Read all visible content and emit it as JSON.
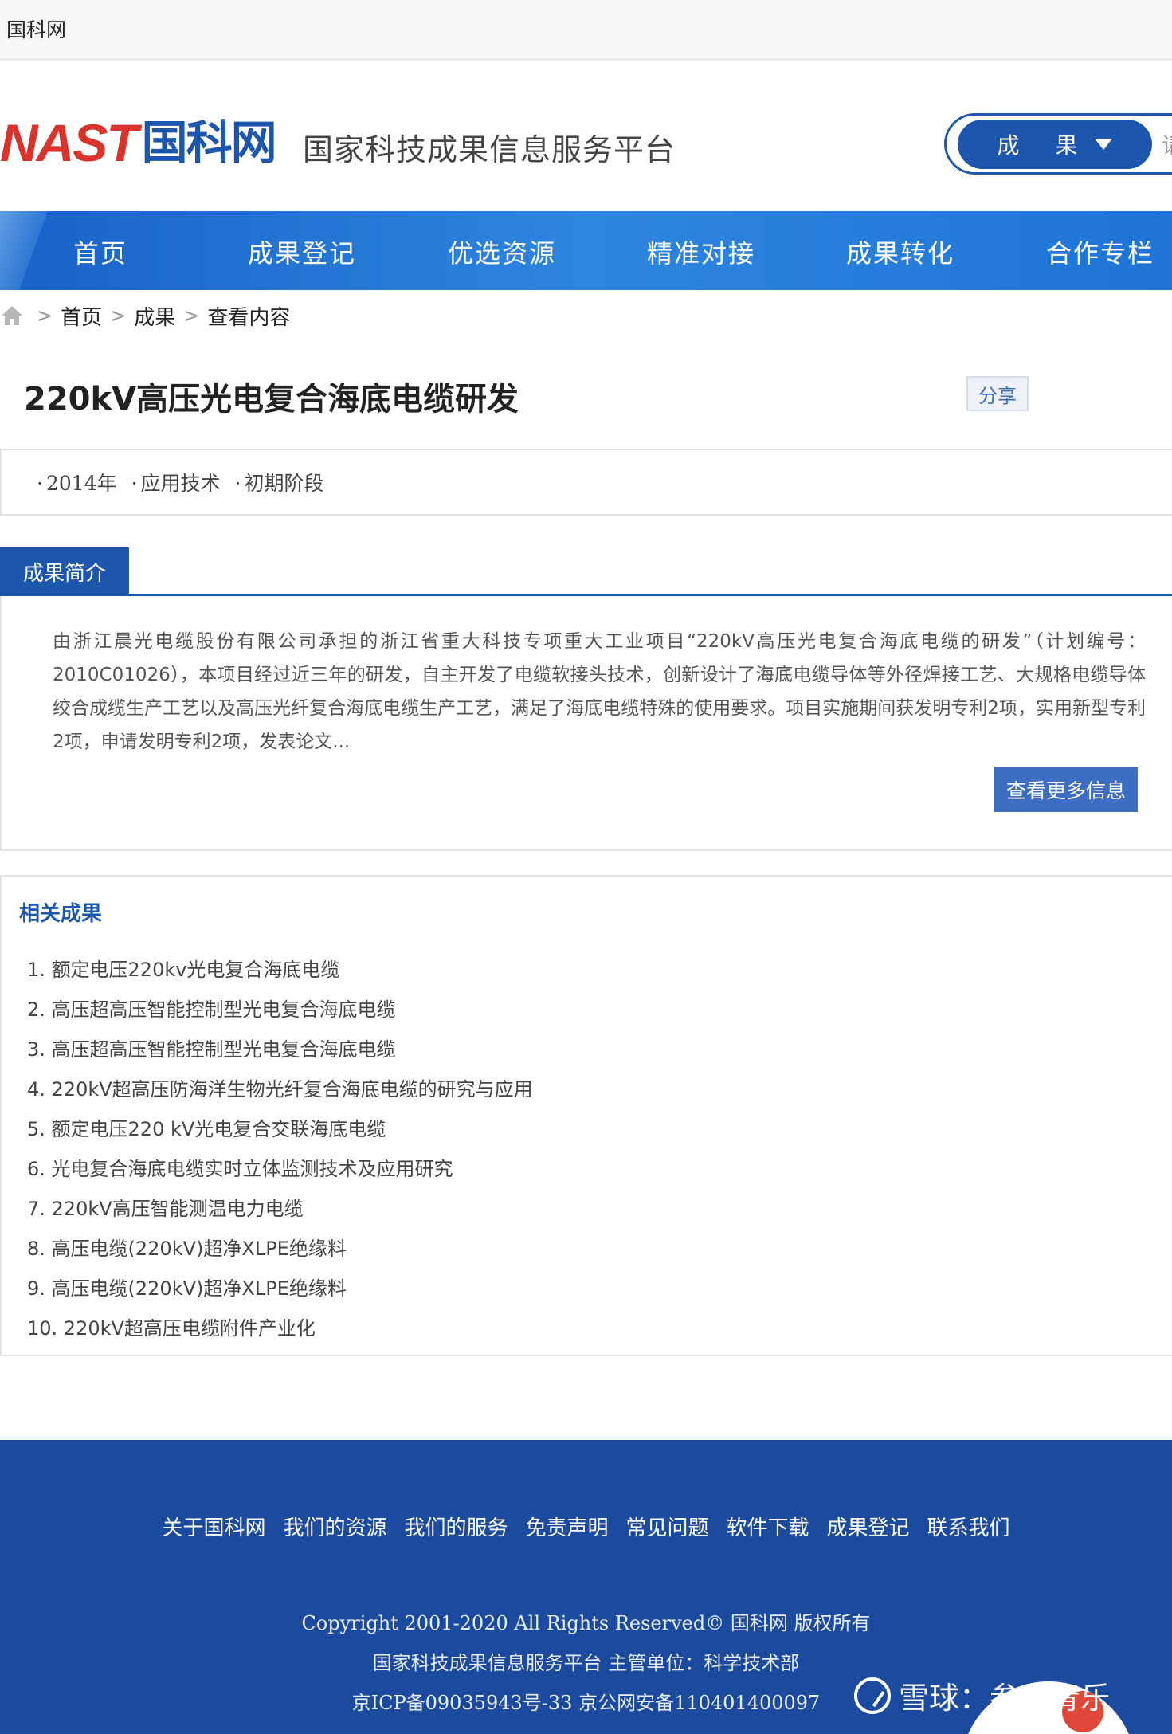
{
  "browser": {
    "tab_title": "国科网"
  },
  "header": {
    "logo_latin": "NAST",
    "logo_cn": "国科网",
    "slogan": "国家科技成果信息服务平台",
    "search": {
      "category": "成 果",
      "placeholder": "请输"
    }
  },
  "nav": {
    "items": [
      {
        "label": "首页"
      },
      {
        "label": "成果登记"
      },
      {
        "label": "优选资源"
      },
      {
        "label": "精准对接"
      },
      {
        "label": "成果转化"
      },
      {
        "label": "合作专栏"
      }
    ]
  },
  "breadcrumb": {
    "items": [
      "首页",
      "成果",
      "查看内容"
    ]
  },
  "article": {
    "title": "220kV高压光电复合海底电缆研发",
    "share_label": "分享",
    "meta": [
      "2014年",
      "应用技术",
      "初期阶段"
    ]
  },
  "summary": {
    "tab_label": "成果简介",
    "text": "由浙江晨光电缆股份有限公司承担的浙江省重大科技专项重大工业项目“220kV高压光电复合海底电缆的研发”（计划编号：2010C01026），本项目经过近三年的研发，自主开发了电缆软接头技术，创新设计了海底电缆导体等外径焊接工艺、大规格电缆导体绞合成缆生产工艺以及高压光纤复合海底电缆生产工艺，满足了海底电缆特殊的使用要求。项目实施期间获发明专利2项，实用新型专利2项，申请发明专利2项，发表论文...",
    "more_label": "查看更多信息"
  },
  "related": {
    "title": "相关成果",
    "items": [
      "1. 额定电压220kv光电复合海底电缆",
      "2. 高压超高压智能控制型光电复合海底电缆",
      "3. 高压超高压智能控制型光电复合海底电缆",
      "4. 220kV超高压防海洋生物光纤复合海底电缆的研究与应用",
      "5. 额定电压220 kV光电复合交联海底电缆",
      "6. 光电复合海底电缆实时立体监测技术及应用研究",
      "7. 220kV高压智能测温电力电缆",
      "8. 高压电缆(220kV)超净XLPE绝缘料",
      "9. 高压电缆(220kV)超净XLPE绝缘料",
      "10. 220kV超高压电缆附件产业化"
    ]
  },
  "footer": {
    "links": [
      "关于国科网",
      "我们的资源",
      "我们的服务",
      "免责声明",
      "常见问题",
      "软件下载",
      "成果登记",
      "联系我们"
    ],
    "copyright": "Copyright 2001-2020 All Rights Reserved© 国科网 版权所有",
    "platform": "国家科技成果信息服务平台  主管单位：科学技术部",
    "icp": "京ICP备09035943号-33  京公网安备110401400097"
  },
  "watermark": {
    "text": "雪球：叁贰青乐"
  }
}
